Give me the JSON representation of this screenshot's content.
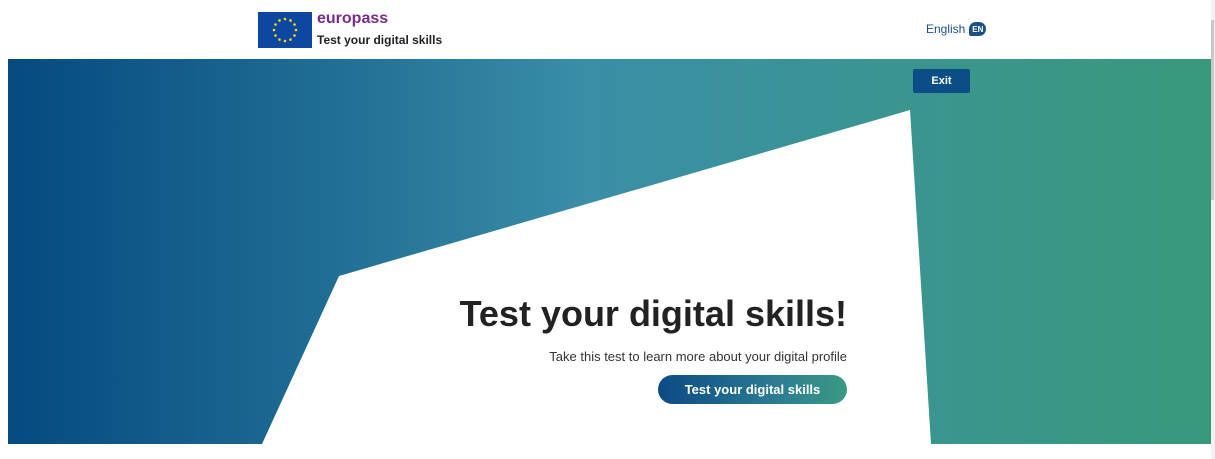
{
  "header": {
    "brand_name": "europass",
    "brand_subtitle": "Test your digital skills",
    "language_label": "English",
    "language_code": "EN"
  },
  "hero": {
    "exit_label": "Exit",
    "title": "Test your digital skills!",
    "subtitle": "Take this test to learn more about your digital profile",
    "cta_label": "Test your digital skills"
  },
  "colors": {
    "brand_purple": "#7b2a8e",
    "primary_blue": "#0b4e86",
    "gradient_start": "#054a80",
    "gradient_end": "#38987a"
  }
}
